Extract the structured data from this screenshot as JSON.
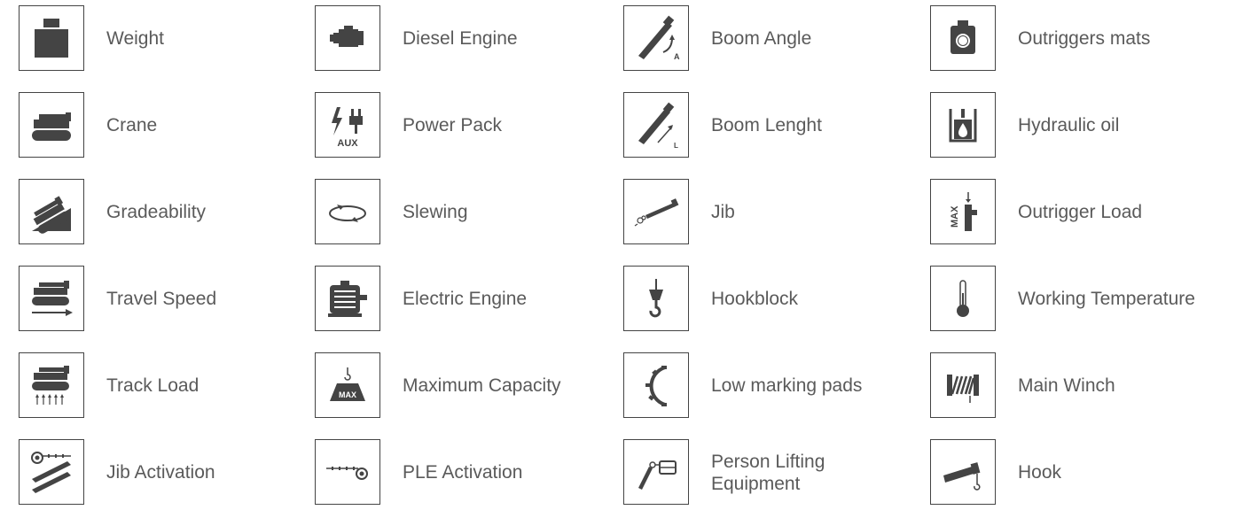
{
  "legend": {
    "items": [
      {
        "label": "Weight",
        "icon": "weight-icon"
      },
      {
        "label": "Diesel Engine",
        "icon": "diesel-engine-icon"
      },
      {
        "label": "Boom Angle",
        "icon": "boom-angle-icon"
      },
      {
        "label": "Outriggers mats",
        "icon": "outriggers-mats-icon"
      },
      {
        "label": "Crane",
        "icon": "crane-icon"
      },
      {
        "label": "Power Pack",
        "icon": "power-pack-icon"
      },
      {
        "label": "Boom Lenght",
        "icon": "boom-length-icon"
      },
      {
        "label": "Hydraulic oil",
        "icon": "hydraulic-oil-icon"
      },
      {
        "label": "Gradeability",
        "icon": "gradeability-icon"
      },
      {
        "label": "Slewing",
        "icon": "slewing-icon"
      },
      {
        "label": "Jib",
        "icon": "jib-icon"
      },
      {
        "label": "Outrigger Load",
        "icon": "outrigger-load-icon"
      },
      {
        "label": "Travel Speed",
        "icon": "travel-speed-icon"
      },
      {
        "label": "Electric Engine",
        "icon": "electric-engine-icon"
      },
      {
        "label": "Hookblock",
        "icon": "hookblock-icon"
      },
      {
        "label": "Working Temperature",
        "icon": "working-temperature-icon"
      },
      {
        "label": "Track Load",
        "icon": "track-load-icon"
      },
      {
        "label": "Maximum Capacity",
        "icon": "maximum-capacity-icon"
      },
      {
        "label": "Low marking pads",
        "icon": "low-marking-pads-icon"
      },
      {
        "label": "Main Winch",
        "icon": "main-winch-icon"
      },
      {
        "label": "Jib Activation",
        "icon": "jib-activation-icon"
      },
      {
        "label": "PLE Activation",
        "icon": "ple-activation-icon"
      },
      {
        "label": "Person Lifting Equipment",
        "icon": "person-lifting-equipment-icon"
      },
      {
        "label": "Hook",
        "icon": "hook-icon"
      }
    ],
    "icon_texts": {
      "boom_angle_letter": "A",
      "boom_length_letter": "L",
      "power_pack_text": "AUX",
      "max_text": "MAX",
      "outrigger_max_text": "MAX"
    },
    "colors": {
      "icon": "#444444",
      "label": "#5a5a5a",
      "border": "#444444"
    }
  }
}
